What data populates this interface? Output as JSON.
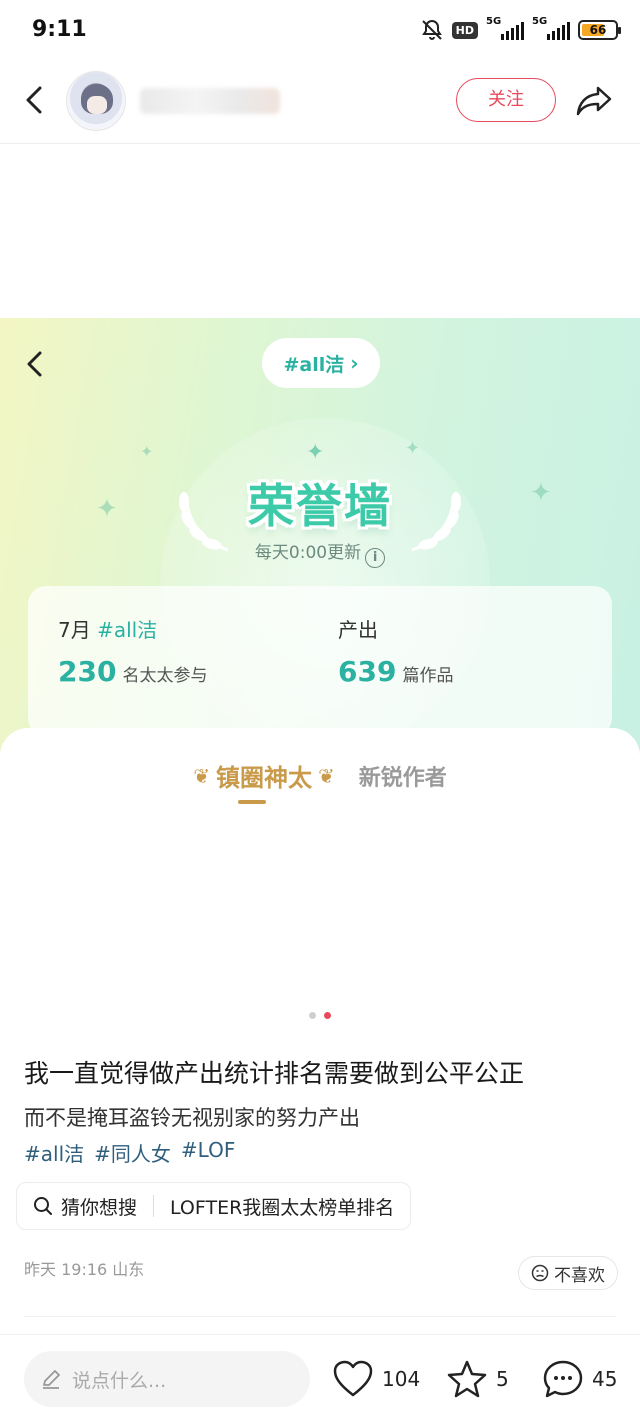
{
  "status_bar": {
    "time": "9:11",
    "hd_label": "HD",
    "net1": "5G",
    "net2": "5G",
    "battery": "66"
  },
  "header": {
    "follow_label": "关注"
  },
  "banner": {
    "topic": "#all洁",
    "title": "荣誉墙",
    "update_text": "每天0:00更新",
    "stats": {
      "month": "7月",
      "month_tag": "#all洁",
      "participants": "230",
      "participants_suffix": "名太太参与",
      "output_label": "产出",
      "works": "639",
      "works_suffix": "篇作品"
    },
    "tabs": {
      "active": "镇圈神太",
      "inactive": "新锐作者"
    }
  },
  "carousel": {
    "count": 2,
    "active_index": 1
  },
  "post": {
    "title": "我一直觉得做产出统计排名需要做到公平公正",
    "subtitle": "而不是掩耳盗铃无视别家的努力产出",
    "tags": [
      "#all洁",
      "#同人女",
      "#LOF"
    ],
    "guess_label": "猜你想搜",
    "guess_query": "LOFTER我圈太太榜单排名",
    "meta": "昨天 19:16 山东",
    "dislike_label": "不喜欢"
  },
  "bottom_bar": {
    "comment_placeholder": "说点什么...",
    "likes": "104",
    "favorites": "5",
    "comments": "45"
  },
  "colors": {
    "accent_red": "#e8495d",
    "teal": "#2bb1a2",
    "gold": "#c99a4a",
    "tag_blue": "#2f5f7c"
  }
}
